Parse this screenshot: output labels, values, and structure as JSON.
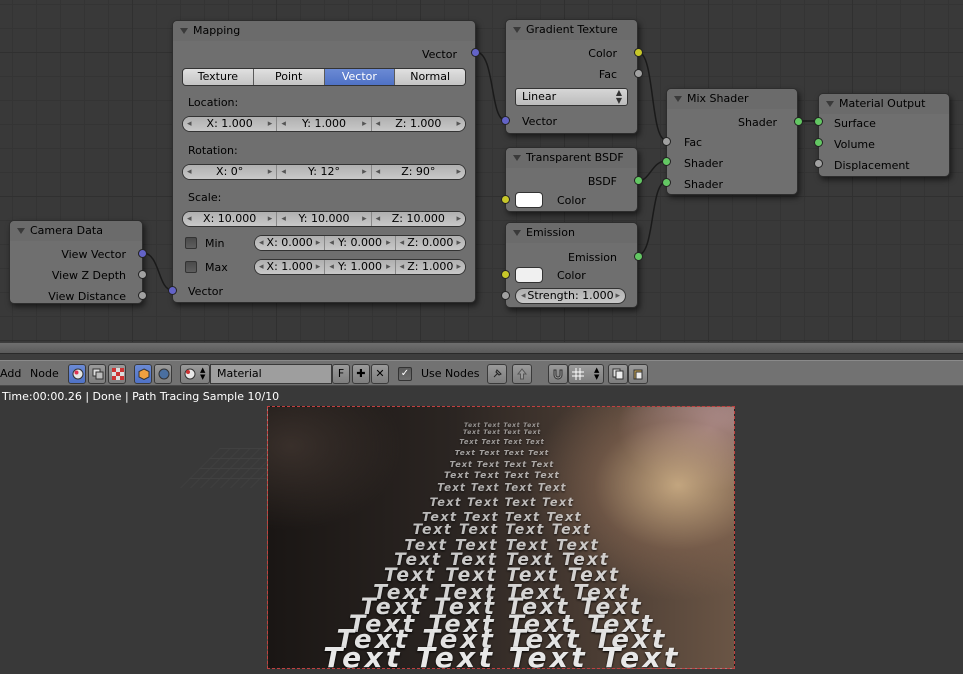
{
  "nodes": {
    "mapping": {
      "title": "Mapping",
      "out_vector": "Vector",
      "tabs": [
        "Texture",
        "Point",
        "Vector",
        "Normal"
      ],
      "active_tab": "Vector",
      "location_label": "Location:",
      "location": [
        "X: 1.000",
        "Y: 1.000",
        "Z: 1.000"
      ],
      "rotation_label": "Rotation:",
      "rotation": [
        "X: 0°",
        "Y: 12°",
        "Z: 90°"
      ],
      "scale_label": "Scale:",
      "scale": [
        "X: 10.000",
        "Y: 10.000",
        "Z: 10.000"
      ],
      "min_label": "Min",
      "min": [
        "X: 0.000",
        "Y: 0.000",
        "Z: 0.000"
      ],
      "max_label": "Max",
      "max": [
        "X: 1.000",
        "Y: 1.000",
        "Z: 1.000"
      ],
      "in_vector": "Vector"
    },
    "camera_data": {
      "title": "Camera Data",
      "outputs": [
        "View Vector",
        "View Z Depth",
        "View Distance"
      ]
    },
    "gradient_texture": {
      "title": "Gradient Texture",
      "outputs": [
        "Color",
        "Fac"
      ],
      "type_value": "Linear",
      "in_vector": "Vector"
    },
    "transparent_bsdf": {
      "title": "Transparent BSDF",
      "output": "BSDF",
      "color_label": "Color"
    },
    "emission": {
      "title": "Emission",
      "output": "Emission",
      "color_label": "Color",
      "strength": "Strength: 1.000"
    },
    "mix_shader": {
      "title": "Mix Shader",
      "output": "Shader",
      "inputs": [
        "Fac",
        "Shader",
        "Shader"
      ]
    },
    "material_output": {
      "title": "Material Output",
      "inputs": [
        "Surface",
        "Volume",
        "Displacement"
      ]
    }
  },
  "toolbar": {
    "add_label": "Add",
    "node_label": "Node",
    "material_name": "Material",
    "fake_user": "F",
    "use_nodes_label": "Use Nodes",
    "use_nodes_checked": true
  },
  "render": {
    "status": "Time:00:00.26 | Done | Path Tracing Sample 10/10",
    "rows": [
      "Text Text Text Text",
      "Text Text Text Text",
      "Text Text Text Text",
      "Text Text Text Text",
      "Text Text Text Text",
      "Text Text Text Text",
      "Text Text Text Text",
      "Text Text Text Text",
      "Text Text Text Text",
      "Text Text Text Text",
      "Text Text Text Text",
      "Text Text Text Text",
      "Text Text Text Text",
      "Text Text Text Text",
      "Text Text Text Text",
      "Text Text Text Text",
      "Text Text Text Text",
      "Text Text Text Text"
    ]
  },
  "colors": {
    "vector_socket": "#6363c7",
    "color_socket": "#c7c729",
    "value_socket": "#a1a1a1",
    "shader_socket": "#63c763",
    "active_blue": "#5680c2"
  }
}
